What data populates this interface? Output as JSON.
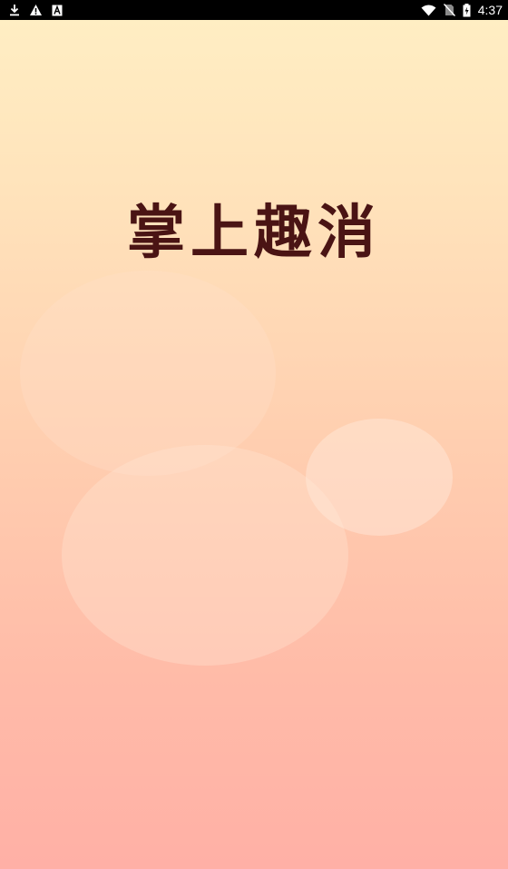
{
  "status_bar": {
    "time": "4:37",
    "left_icons": [
      "download-icon",
      "warning-icon",
      "font-a-icon"
    ],
    "right_icons": [
      "wifi-icon",
      "no-sim-icon",
      "battery-charging-icon"
    ]
  },
  "splash": {
    "app_name": "掌上趣消"
  },
  "colors": {
    "title": "#4a1414",
    "gradient_top": "#ffefc4",
    "gradient_bottom": "#ffb0a6",
    "status_bar": "#000000"
  }
}
